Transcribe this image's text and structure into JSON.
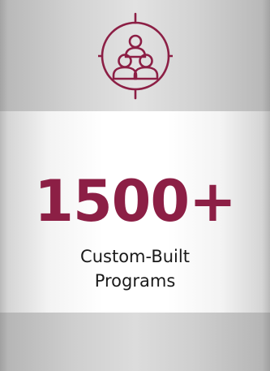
{
  "colors": {
    "accent": "#8c1f45",
    "text": "#1a1a1a"
  },
  "card": {
    "icon": "audience-target-icon",
    "stat_value": "1500+",
    "label_line1": "Custom-Built",
    "label_line2": "Programs"
  }
}
